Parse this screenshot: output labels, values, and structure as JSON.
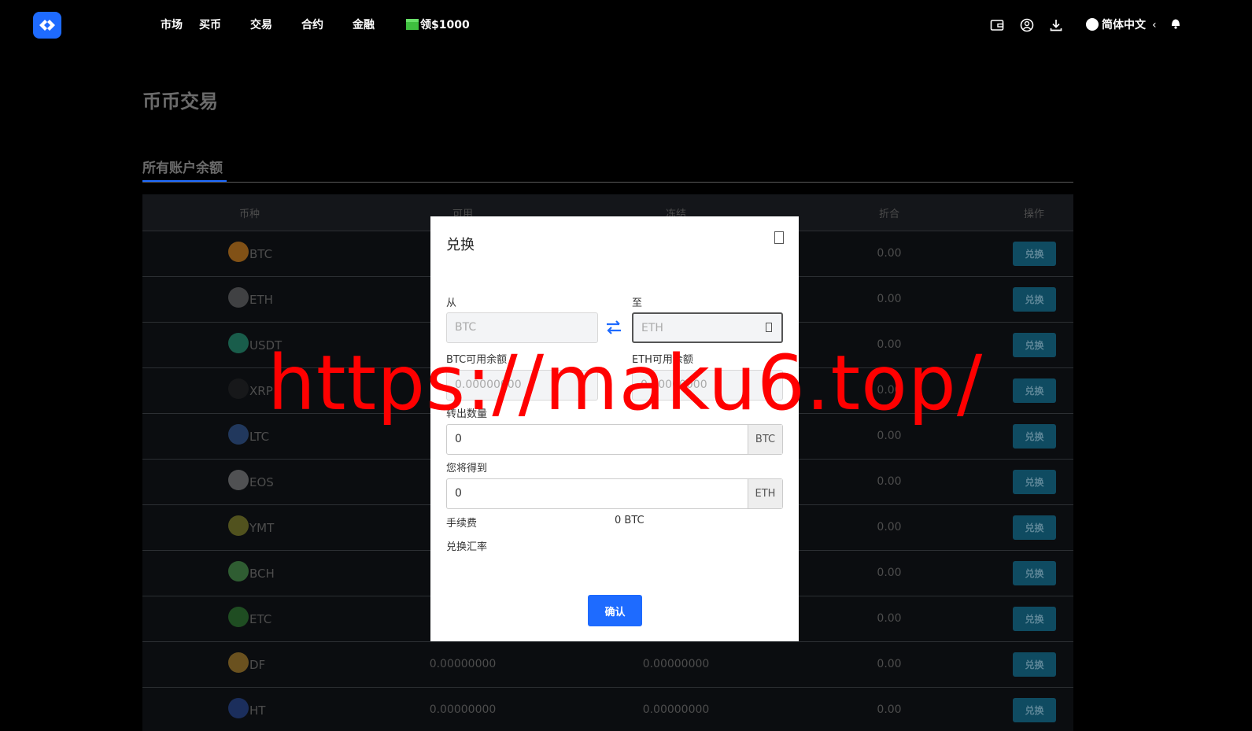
{
  "nav": {
    "items": [
      "市场",
      "买币",
      "交易",
      "合约",
      "金融"
    ],
    "promo": "领$1000",
    "language": "简体中文",
    "chevron": "‹"
  },
  "page": {
    "title": "币币交易",
    "section_title": "所有账户余额"
  },
  "table": {
    "headers": [
      "币种",
      "可用",
      "冻结",
      "折合",
      "操作"
    ],
    "rows": [
      {
        "coin": "BTC",
        "available": "",
        "frozen": "",
        "value": "0.00",
        "action": "兑换",
        "color": "#e38b1b"
      },
      {
        "coin": "ETH",
        "available": "",
        "frozen": "",
        "value": "0.00",
        "action": "兑换",
        "color": "#6d6d6d"
      },
      {
        "coin": "USDT",
        "available": "",
        "frozen": "",
        "value": "0.00",
        "action": "兑换",
        "color": "#26a17b"
      },
      {
        "coin": "XRP",
        "available": "",
        "frozen": "",
        "value": "0.00",
        "action": "兑换",
        "color": "#222222"
      },
      {
        "coin": "LTC",
        "available": "",
        "frozen": "",
        "value": "0.00",
        "action": "兑换",
        "color": "#345d9d"
      },
      {
        "coin": "EOS",
        "available": "",
        "frozen": "",
        "value": "0.00",
        "action": "兑换",
        "color": "#8a8a8a"
      },
      {
        "coin": "YMT",
        "available": "",
        "frozen": "",
        "value": "0.00",
        "action": "兑换",
        "color": "#8d8d2a"
      },
      {
        "coin": "BCH",
        "available": "",
        "frozen": "",
        "value": "0.00",
        "action": "兑换",
        "color": "#4fa14f"
      },
      {
        "coin": "ETC",
        "available": "",
        "frozen": "",
        "value": "0.00",
        "action": "兑换",
        "color": "#328332"
      },
      {
        "coin": "DF",
        "available": "0.00000000",
        "frozen": "0.00000000",
        "value": "0.00",
        "action": "兑换",
        "color": "#b98a2c"
      },
      {
        "coin": "HT",
        "available": "0.00000000",
        "frozen": "0.00000000",
        "value": "0.00",
        "action": "兑换",
        "color": "#2a4a9a"
      }
    ]
  },
  "modal": {
    "title": "兑换",
    "from_label": "从",
    "to_label": "至",
    "from_value": "BTC",
    "to_value": "ETH",
    "from_balance_label": "BTC可用余额",
    "to_balance_label": "ETH可用余额",
    "from_balance_value": "0.00000000",
    "to_balance_value": "0.00000000",
    "out_amount_label": "转出数量",
    "out_amount_value": "0",
    "out_unit": "BTC",
    "receive_label": "您将得到",
    "receive_value": "0",
    "receive_unit": "ETH",
    "fee_label": "手续费",
    "fee_value": "0 BTC",
    "rate_label": "兑换汇率",
    "confirm_label": "确认"
  },
  "watermark": "https://maku6.top/",
  "colors": {
    "accent": "#1e6bff",
    "button_dark": "#0f4b61",
    "watermark": "#ff0000"
  }
}
